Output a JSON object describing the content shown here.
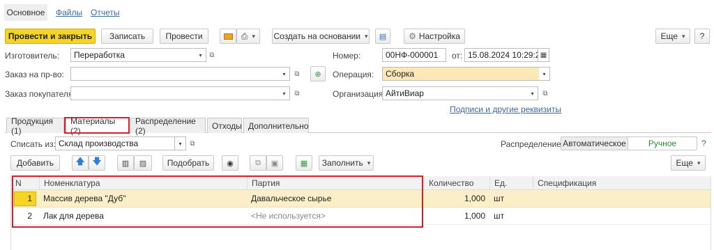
{
  "top_tabs": [
    "Основное",
    "Файлы",
    "Отчеты"
  ],
  "toolbar": {
    "post_close": "Провести и закрыть",
    "save": "Записать",
    "post": "Провести",
    "create_based": "Создать на основании",
    "settings": "Настройка",
    "more": "Еще",
    "help": "?"
  },
  "form": {
    "maker_label": "Изготовитель:",
    "maker_value": "Переработка",
    "order_label": "Заказ на пр-во:",
    "order_value": "",
    "customer_order_label": "Заказ покупателя:",
    "customer_order_value": "",
    "number_label": "Номер:",
    "number_value": "00НФ-000001",
    "from_label": "от:",
    "date_value": "15.08.2024 10:29:24",
    "operation_label": "Операция:",
    "operation_value": "Сборка",
    "org_label": "Организация:",
    "org_value": "АйтиВиар",
    "signatures_link": "Подписи и другие реквизиты"
  },
  "tabs": [
    "Продукция (1)",
    "Материалы (2)",
    "Распределение (2)",
    "Отходы",
    "Дополнительно"
  ],
  "materials": {
    "write_off_label": "Списать из:",
    "write_off_value": "Склад производства",
    "distribution_label": "Распределение:",
    "dist_auto": "Автоматическое",
    "dist_manual": "Ручное",
    "add": "Добавить",
    "pick": "Подобрать",
    "fill": "Заполнить",
    "more": "Еще",
    "columns": [
      "N",
      "Номенклатура",
      "Партия",
      "Количество",
      "Ед.",
      "Спецификация"
    ],
    "rows": [
      {
        "n": "1",
        "name": "Массив дерева \"Дуб\"",
        "batch": "Давальческое сырье",
        "qty": "1,000",
        "unit": "шт",
        "spec": ""
      },
      {
        "n": "2",
        "name": "Лак для дерева",
        "batch": "<Не используется>",
        "qty": "1,000",
        "unit": "шт",
        "spec": ""
      }
    ]
  },
  "colors": {
    "accent": "#f5d327",
    "highlight_row": "#fbefc8",
    "red_frame": "#d4202a",
    "link": "#3a6ba5",
    "manual_green": "#2f8a2f"
  }
}
